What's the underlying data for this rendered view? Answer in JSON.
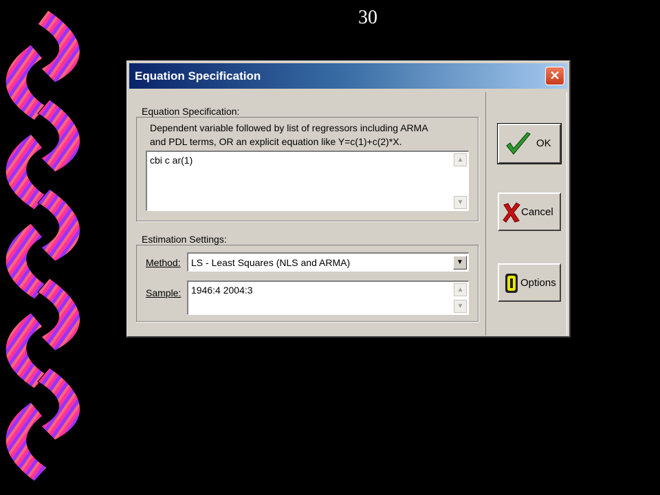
{
  "slide": {
    "number": "30"
  },
  "dialog": {
    "title": "Equation Specification",
    "close_label": "✕",
    "equation_group": {
      "label": "Equation Specification:",
      "description_line1": "Dependent variable followed by list of regressors including ARMA",
      "description_line2": "and PDL terms, OR an explicit equation like Y=c(1)+c(2)*X.",
      "value": "cbi c ar(1)"
    },
    "estimation_group": {
      "label": "Estimation Settings:",
      "method_label": "Method:",
      "method_value": "LS  -  Least Squares (NLS and ARMA)",
      "sample_label": "Sample:",
      "sample_value": "1946:4 2004:3"
    },
    "buttons": {
      "ok": "OK",
      "cancel": "Cancel",
      "options": "Options"
    }
  },
  "colors": {
    "title_bar_start": "#0a246a",
    "title_bar_end": "#a6caf0",
    "dialog_face": "#d4d0c8",
    "decor_pink": "#ff3399",
    "decor_purple": "#9933ff",
    "decor_salmon": "#ff6677",
    "ok_check": "#2e9a2e",
    "cancel_x": "#cc1111",
    "options_icon": "#e8e800"
  }
}
